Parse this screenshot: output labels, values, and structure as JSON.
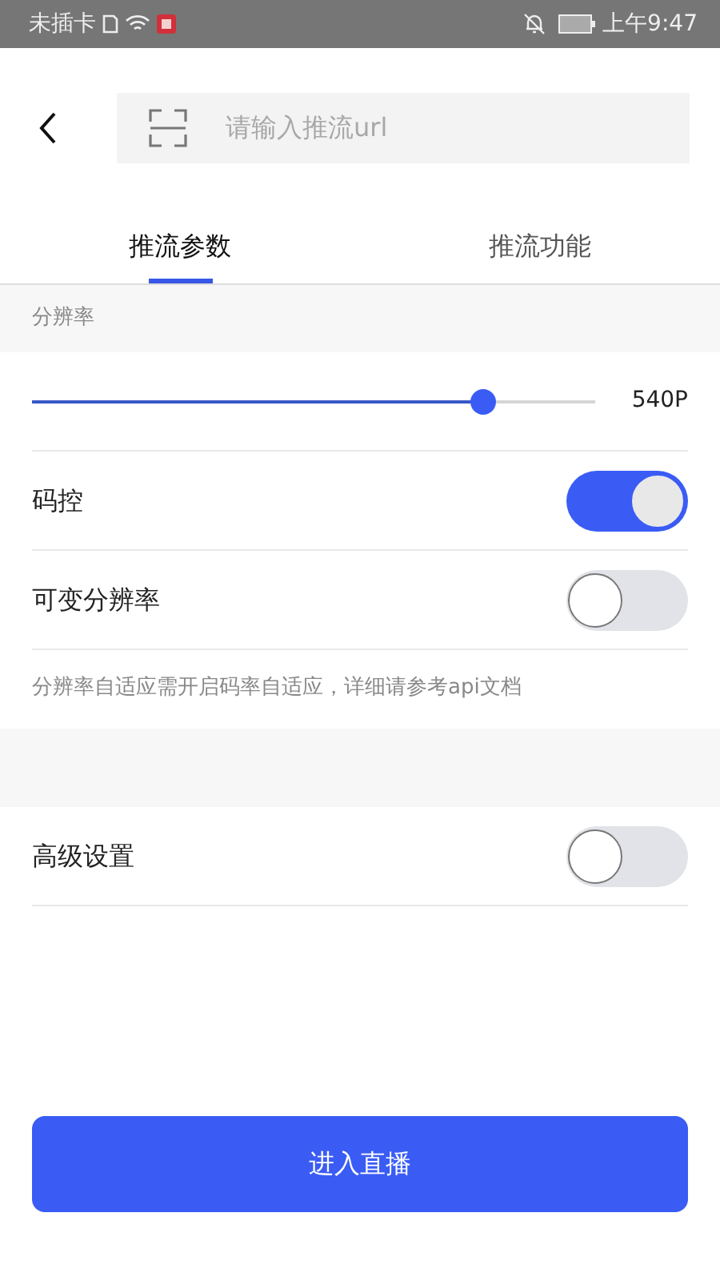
{
  "status_bar": {
    "carrier": "未插卡",
    "time": "上午9:47"
  },
  "search": {
    "placeholder": "请输入推流url"
  },
  "tabs": [
    {
      "label": "推流参数",
      "selected": true
    },
    {
      "label": "推流功能",
      "selected": false
    }
  ],
  "section_title": "分辨率",
  "resolution": {
    "level": 0.8,
    "reading": "540P"
  },
  "toggles": [
    {
      "label": "码控",
      "on": true
    },
    {
      "label": "可变分辨率",
      "on": false
    }
  ],
  "note": "分辨率自适应需开启码率自适应，详细请参考api文档",
  "advanced": {
    "label": "高级设置",
    "on": false
  },
  "primary_button": "进入直播"
}
